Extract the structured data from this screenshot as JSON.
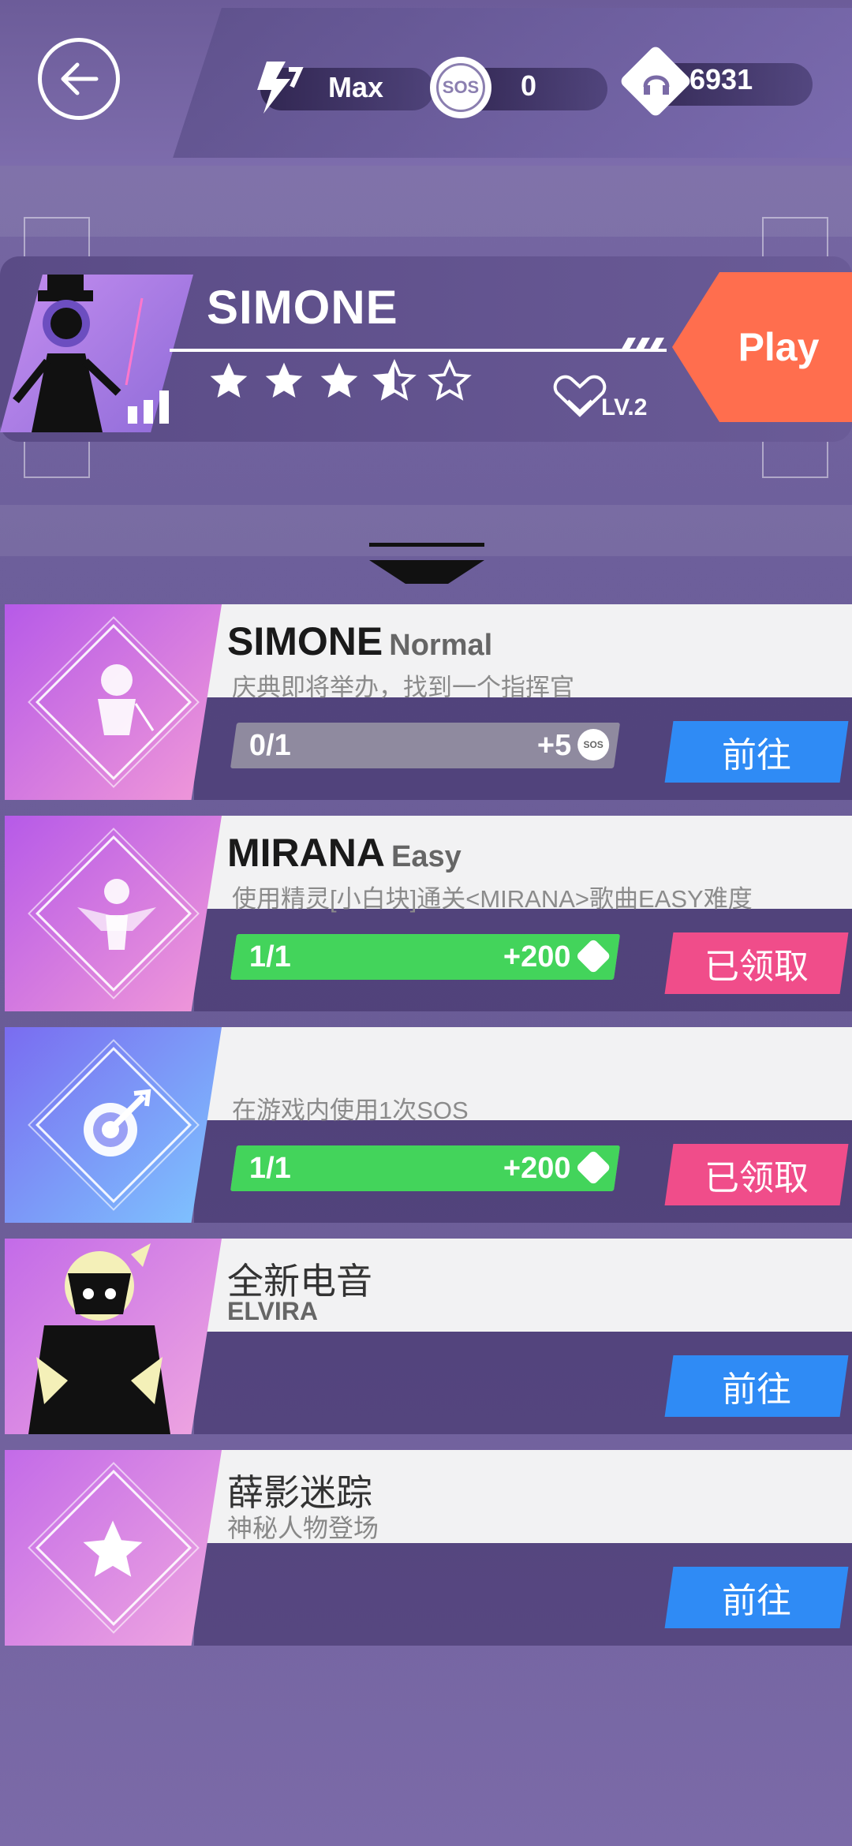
{
  "topbar": {
    "stamina_label": "Max",
    "sos_icon_text": "SOS",
    "sos_count": "0",
    "currency_count": "6931"
  },
  "character": {
    "name": "SIMONE",
    "rating_stars": 3.5,
    "rating_max": 5,
    "level_label": "LV.2",
    "play_label": "Play"
  },
  "missions": [
    {
      "title": "SIMONE",
      "difficulty": "Normal",
      "description": "庆典即将举办，找到一个指挥官",
      "progress_text": "0/1",
      "progress_ratio": 0,
      "reward_text": "+5",
      "reward_icon": "sos-icon",
      "button_label": "前往",
      "button_color": "#2f8bf5"
    },
    {
      "title": "MIRANA",
      "difficulty": "Easy",
      "description": "使用精灵[小白块]通关<MIRANA>歌曲EASY难度",
      "progress_text": "1/1",
      "progress_ratio": 1,
      "reward_text": "+200",
      "reward_icon": "currency-icon",
      "button_label": "已领取",
      "button_color": "#f04d8a"
    },
    {
      "title": "",
      "difficulty": "",
      "description": "在游戏内使用1次SOS",
      "progress_text": "1/1",
      "progress_ratio": 1,
      "reward_text": "+200",
      "reward_icon": "currency-icon",
      "button_label": "已领取",
      "button_color": "#f04d8a"
    },
    {
      "title": "全新电音",
      "subtitle": "ELVIRA",
      "button_label": "前往",
      "button_color": "#2f8bf5"
    },
    {
      "title": "薛影迷踪",
      "subtitle": "神秘人物登场",
      "button_label": "前往",
      "button_color": "#2f8bf5"
    }
  ]
}
